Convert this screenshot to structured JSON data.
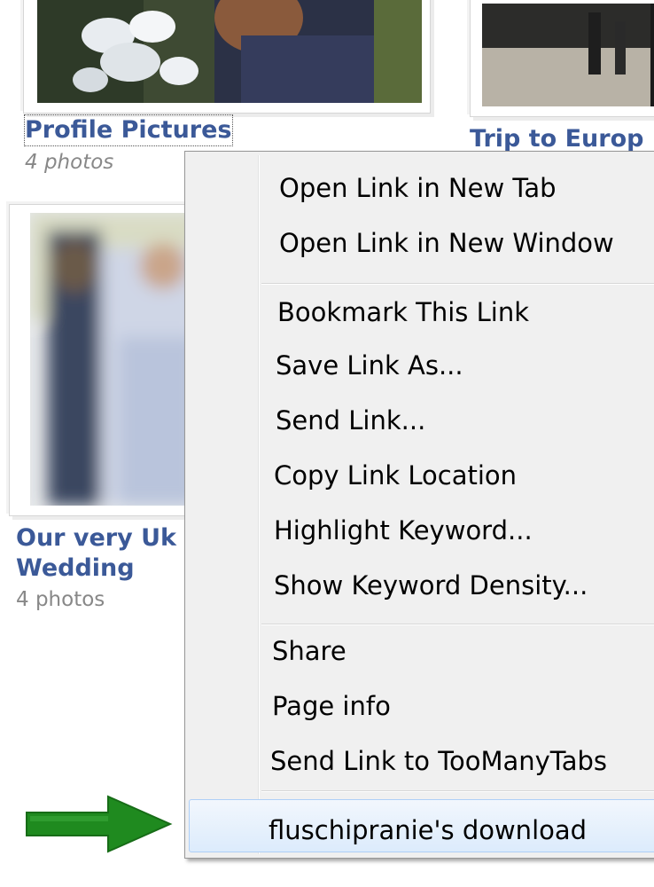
{
  "albums": [
    {
      "title": "Profile Pictures",
      "count": "4 photos"
    },
    {
      "title": "Trip to Europ",
      "count": ""
    },
    {
      "title_line1": "Our very Uk",
      "title_line2": "Wedding",
      "count": "4 photos"
    }
  ],
  "context_menu": {
    "items": [
      "Open Link in New Tab",
      "Open Link in New Window",
      "Bookmark This Link",
      "Save Link As...",
      "Send Link...",
      "Copy Link Location",
      "Highlight Keyword...",
      "Show Keyword Density...",
      "Share",
      "Page info",
      "Send Link to TooManyTabs",
      "fluschipranie's download"
    ],
    "highlighted_item": "fluschipranie's download"
  },
  "icons": {
    "arrow": "right-arrow-icon"
  },
  "colors": {
    "link": "#3b5998",
    "arrow": "#1f8a1f",
    "menu_bg": "#f0f0f0",
    "hover_border": "#aecff7"
  }
}
